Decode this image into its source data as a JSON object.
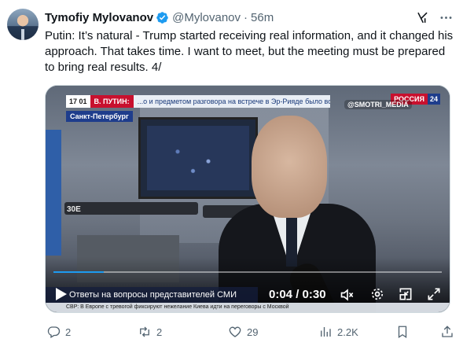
{
  "tweet": {
    "author_name": "Tymofiy Mylovanov",
    "handle": "@Mylovanov",
    "separator": "·",
    "time": "56m",
    "text": "Putin: It’s natural - Trump started receiving real information, and it changed his approach. That takes time. I want to meet, but the meeting must be prepared to bring real results. 4/"
  },
  "video": {
    "overlay_time": "17 01",
    "overlay_putin": "В. ПУТИН:",
    "overlay_ticker": "...о и предметом разговора на встрече в Эр-Рияде было восстановление",
    "channel_red": "РОССИЯ",
    "channel_num": "24",
    "city": "Санкт-Петербург",
    "watermark": "@SMOTRI_MEDIA",
    "drone_label": "30E",
    "caption": "Ответы на вопросы представителей СМИ",
    "sub_ticker": "СВР: В Европе с тревогой фиксируют нежелание Киева идти на переговоры с Москвой",
    "timecode": "0:04 / 0:30",
    "progress": 0.13
  },
  "actions": {
    "replies": "2",
    "reposts": "2",
    "likes": "29",
    "views": "2.2K"
  },
  "colors": {
    "accent": "#1d9bf0",
    "text_secondary": "#536471",
    "verified": "#1d9bf0"
  },
  "icons": {
    "verified": "verified-badge-icon",
    "grok": "grok-icon",
    "more": "more-icon",
    "reply": "reply-icon",
    "repost": "repost-icon",
    "like": "heart-icon",
    "views": "views-icon",
    "bookmark": "bookmark-icon",
    "share": "share-icon"
  }
}
